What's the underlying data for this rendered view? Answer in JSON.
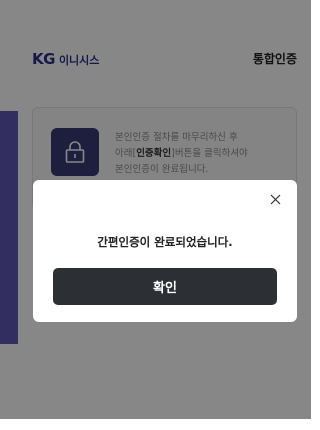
{
  "header": {
    "brand_logo": "KG",
    "brand_name": "이니시스",
    "title": "통합인증"
  },
  "info_card": {
    "icon": "lock-icon",
    "text_line1": "본인인증 절차를 마무리하신 후",
    "text_line2_prefix": "아래[",
    "text_line2_bold": "인증확인",
    "text_line2_suffix": "]버튼을 클릭하셔야",
    "text_line3": "본인인증이 완료됩니다."
  },
  "dialog": {
    "close_icon": "close-icon",
    "message": "간편인증이 완료되었습니다.",
    "confirm_label": "확인"
  },
  "colors": {
    "side_panel": "#5f5ab6",
    "brand": "#2c2f8a",
    "lock_box": "#3a3a78",
    "confirm_button": "#2c2f33"
  }
}
